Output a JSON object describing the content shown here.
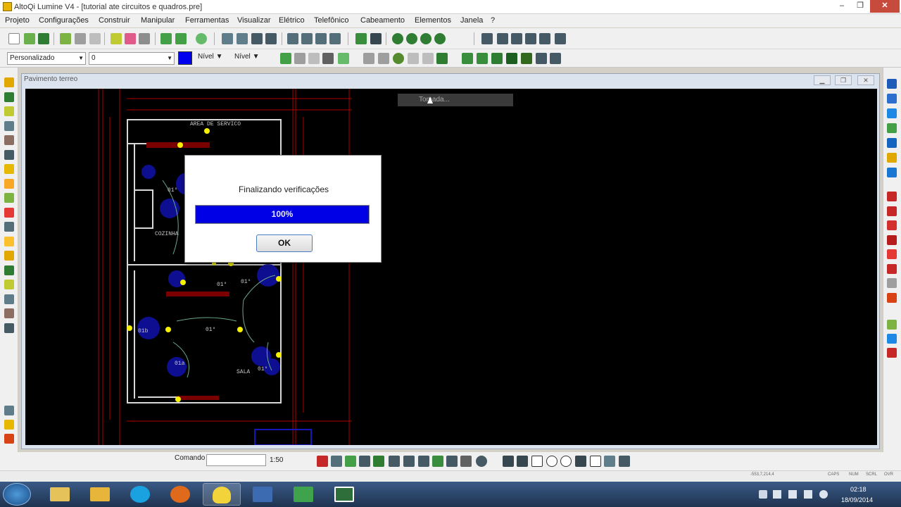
{
  "window": {
    "title": "AltoQi Lumine V4 - [tutorial ate circuitos e quadros.pre]",
    "minimize_label": "–",
    "maximize_label": "❐",
    "close_label": "✕"
  },
  "menu": [
    "Projeto",
    "Configurações",
    "Construir",
    "Manipular",
    "Ferramentas",
    "Visualizar",
    "Elétrico",
    "Telefônico",
    "Cabeamento",
    "Elementos",
    "Janela",
    "?"
  ],
  "toolbar": {
    "style_combo": "Personalizado",
    "layer_combo": "0",
    "color_hex": "#0000ee",
    "level_label_1": "Nível",
    "level_label_2": "Nível"
  },
  "document": {
    "title": "Pavimento terreo",
    "tooltip": "Tomada..."
  },
  "drawing_labels": {
    "area_servico": "AREA DE SERVICO",
    "cozinha": "COZINHA",
    "sala": "SALA"
  },
  "dialog": {
    "message": "Finalizando verificações",
    "progress_text": "100%",
    "progress_value": 1.0,
    "ok_label": "OK"
  },
  "command": {
    "label": "Comando",
    "value": "",
    "scale": "1:50"
  },
  "status": {
    "coords": "-553,7,214,4",
    "indicators": [
      "CAPS",
      "NUM",
      "SCRL",
      "OVR"
    ]
  },
  "taskbar": {
    "apps": [
      "explorer",
      "outlook",
      "skype",
      "firefox",
      "lumine",
      "altoqi-tool",
      "camtasia",
      "clip-editor"
    ],
    "time": "02:18",
    "date": "18/09/2014"
  }
}
